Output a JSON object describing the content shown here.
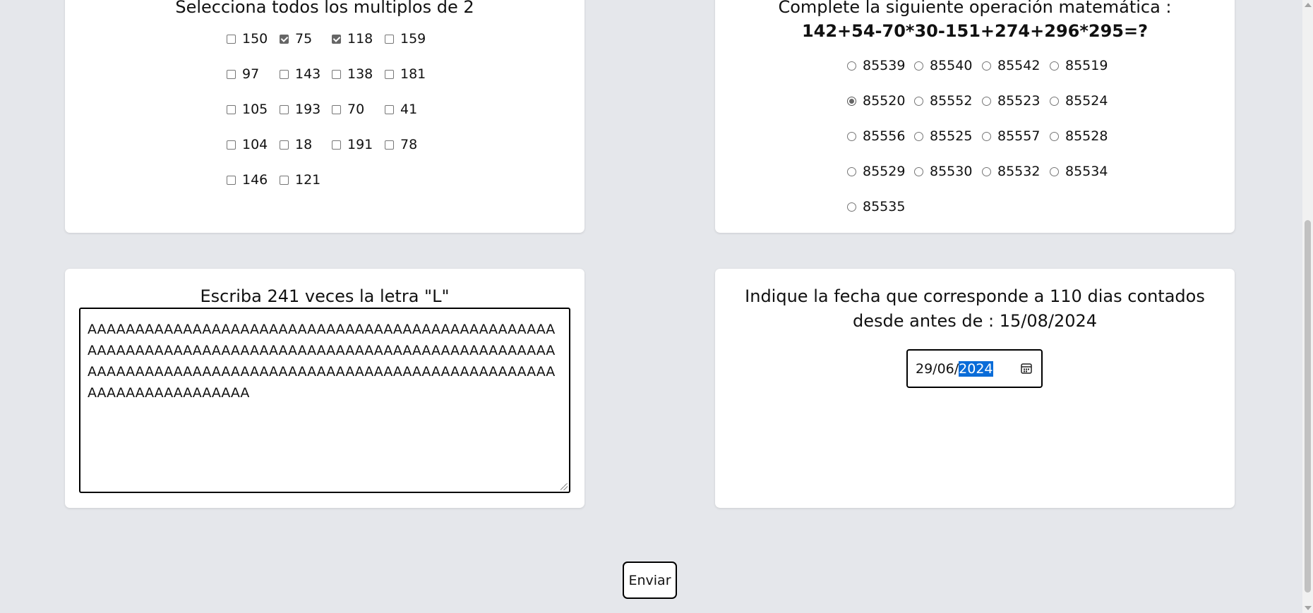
{
  "multiples": {
    "title": "Selecciona todos los multiplos de 2",
    "options": [
      {
        "label": "150",
        "checked": false
      },
      {
        "label": "75",
        "checked": true
      },
      {
        "label": "118",
        "checked": true
      },
      {
        "label": "159",
        "checked": false
      },
      {
        "label": "97",
        "checked": false
      },
      {
        "label": "143",
        "checked": false
      },
      {
        "label": "138",
        "checked": false
      },
      {
        "label": "181",
        "checked": false
      },
      {
        "label": "105",
        "checked": false
      },
      {
        "label": "193",
        "checked": false
      },
      {
        "label": "70",
        "checked": false
      },
      {
        "label": "41",
        "checked": false
      },
      {
        "label": "104",
        "checked": false
      },
      {
        "label": "18",
        "checked": false
      },
      {
        "label": "191",
        "checked": false
      },
      {
        "label": "78",
        "checked": false
      },
      {
        "label": "146",
        "checked": false
      },
      {
        "label": "121",
        "checked": false
      }
    ]
  },
  "math": {
    "title": "Complete la siguiente operación matemática :",
    "expression": "142+54-70*30-151+274+296*295=?",
    "options": [
      {
        "label": "85539",
        "selected": false
      },
      {
        "label": "85540",
        "selected": false
      },
      {
        "label": "85542",
        "selected": false
      },
      {
        "label": "85519",
        "selected": false
      },
      {
        "label": "85520",
        "selected": true
      },
      {
        "label": "85552",
        "selected": false
      },
      {
        "label": "85523",
        "selected": false
      },
      {
        "label": "85524",
        "selected": false
      },
      {
        "label": "85556",
        "selected": false
      },
      {
        "label": "85525",
        "selected": false
      },
      {
        "label": "85557",
        "selected": false
      },
      {
        "label": "85528",
        "selected": false
      },
      {
        "label": "85529",
        "selected": false
      },
      {
        "label": "85530",
        "selected": false
      },
      {
        "label": "85532",
        "selected": false
      },
      {
        "label": "85534",
        "selected": false
      },
      {
        "label": "85535",
        "selected": false
      }
    ]
  },
  "letters": {
    "title": "Escriba 241 veces la letra \"L\"",
    "value": "AAAAAAAAAAAAAAAAAAAAAAAAAAAAAAAAAAAAAAAAAAAAAAAAAAAAAAAAAAAAAAAAAAAAAAAAAAAAAAAAAAAAAAAAAAAAAAAAAAAAAAAAAAAAAAAAAAAAAAAAAAAAAAAAAAAAAAAAAAAAAAAAAAAAAAAAAAAAAAAAAAAA"
  },
  "date": {
    "title": "Indique la fecha que corresponde a 110 dias contados desde antes de : 15/08/2024",
    "value_prefix": "29/06/",
    "value_selected": "2024"
  },
  "submit_label": "Enviar",
  "colors": {
    "background": "#e5e7eb",
    "card": "#ffffff",
    "selection": "#0a6cd8"
  }
}
